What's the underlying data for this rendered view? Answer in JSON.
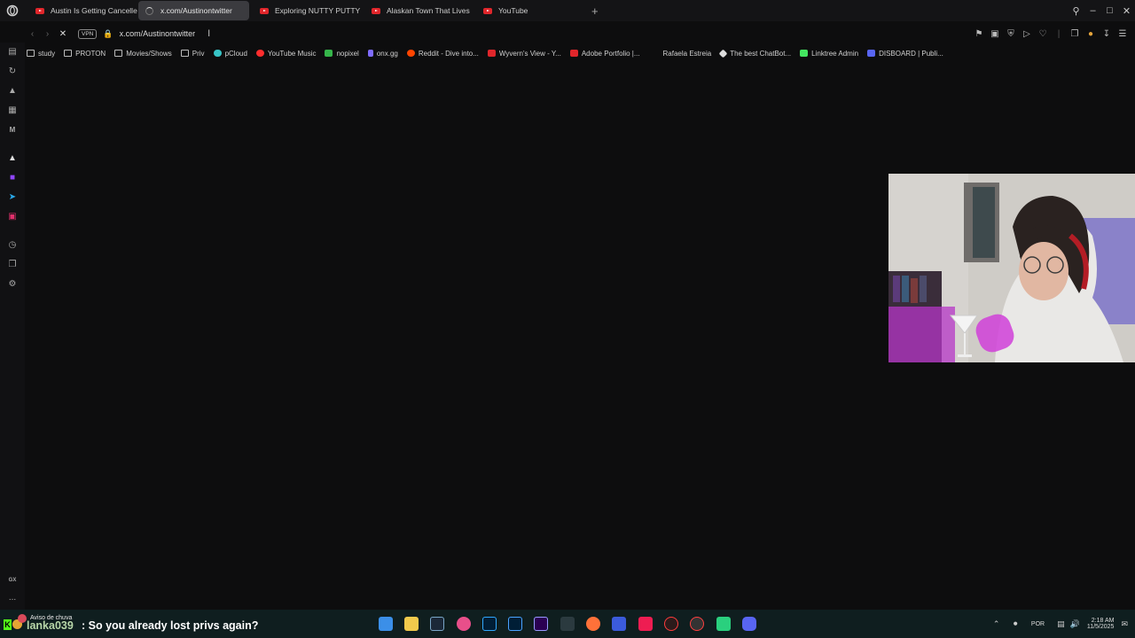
{
  "browser": {
    "tabs": [
      {
        "label": "Austin Is Getting Cancelle",
        "icon": "youtube-icon",
        "active": false
      },
      {
        "label": "x.com/Austinontwitter",
        "icon": "loading-spinner-icon",
        "active": true
      },
      {
        "label": "Exploring NUTTY PUTTY",
        "icon": "youtube-icon",
        "active": false
      },
      {
        "label": "Alaskan Town That Lives",
        "icon": "youtube-icon",
        "active": false
      },
      {
        "label": "YouTube",
        "icon": "youtube-icon",
        "active": false
      }
    ],
    "new_tab": "+",
    "address": {
      "vpn_label": "VPN",
      "url": "x.com/Austinontwitter"
    },
    "bookmarks": [
      {
        "label": "study",
        "icon": "folder-icon",
        "color": ""
      },
      {
        "label": "PROTON",
        "icon": "folder-icon",
        "color": ""
      },
      {
        "label": "Movies/Shows",
        "icon": "folder-icon",
        "color": ""
      },
      {
        "label": "Priv",
        "icon": "folder-icon",
        "color": ""
      },
      {
        "label": "pCloud",
        "icon": "cloud-icon",
        "color": "#37c4c6"
      },
      {
        "label": "YouTube Music",
        "icon": "youtube-music-icon",
        "color": "#ff2d2d"
      },
      {
        "label": "nopixel",
        "icon": "nopixel-icon",
        "color": "#35b54a"
      },
      {
        "label": "onx.gg",
        "icon": "onx-icon",
        "color": "#7f6cff"
      },
      {
        "label": "Reddit - Dive into...",
        "icon": "reddit-icon",
        "color": "#ff4500"
      },
      {
        "label": "Wyvern's View - Y...",
        "icon": "youtube-icon",
        "color": "#e0262b"
      },
      {
        "label": "Adobe Portfolio |...",
        "icon": "adobe-icon",
        "color": "#e0262b"
      },
      {
        "label": "Rafaela Estreia",
        "icon": "",
        "color": ""
      },
      {
        "label": "The best ChatBot...",
        "icon": "chatbot-icon",
        "color": "#dddddd"
      },
      {
        "label": "Linktree Admin",
        "icon": "linktree-icon",
        "color": "#43e660"
      },
      {
        "label": "DISBOARD | Publi...",
        "icon": "disboard-icon",
        "color": "#5865f2"
      }
    ]
  },
  "sidebar": {
    "gx_label": "GX",
    "more": "..."
  },
  "chat": {
    "notice": "Aviso de chuva",
    "username": "lanka039",
    "message": ": So you already lost privs again?"
  },
  "tray": {
    "lang": "POR",
    "time": "2:18 AM",
    "date": "11/5/2025"
  }
}
